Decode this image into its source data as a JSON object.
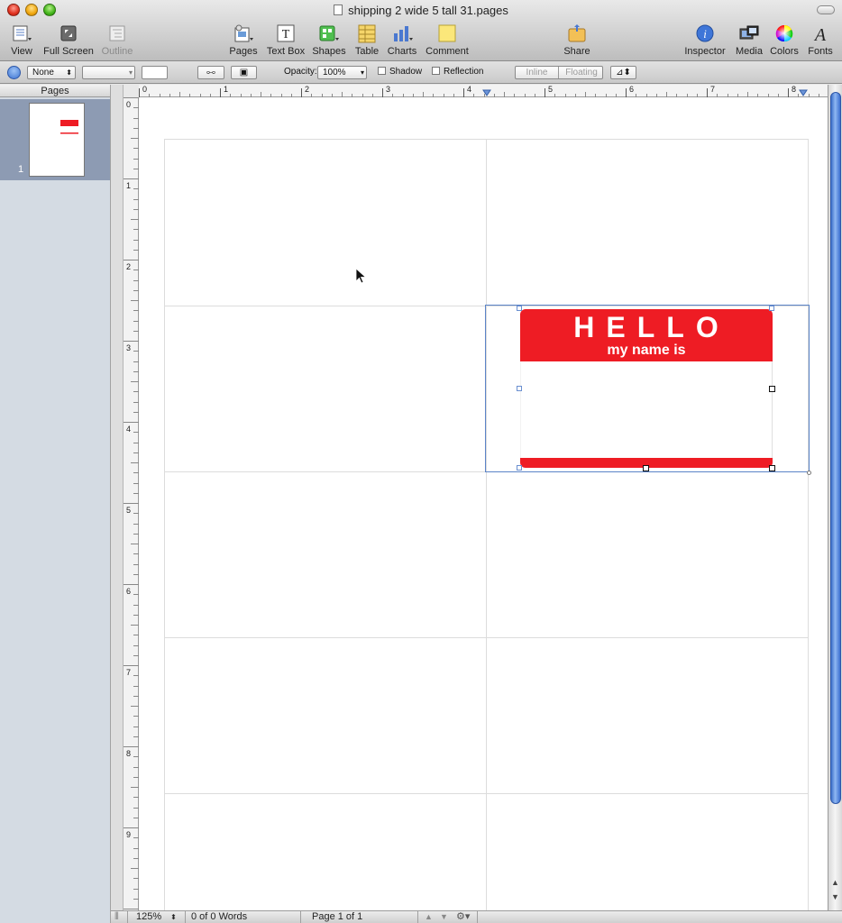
{
  "window": {
    "title": "shipping 2 wide 5 tall 31.pages"
  },
  "toolbar": {
    "view": "View",
    "full_screen": "Full Screen",
    "outline": "Outline",
    "pages": "Pages",
    "text_box": "Text Box",
    "shapes": "Shapes",
    "table": "Table",
    "charts": "Charts",
    "comment": "Comment",
    "share": "Share",
    "inspector": "Inspector",
    "media": "Media",
    "colors": "Colors",
    "fonts": "Fonts"
  },
  "format_bar": {
    "fill_select": "None",
    "opacity_label": "Opacity:",
    "opacity_value": "100%",
    "shadow_label": "Shadow",
    "reflection_label": "Reflection",
    "inline_label": "Inline",
    "floating_label": "Floating"
  },
  "sidebar": {
    "header": "Pages",
    "thumbnail_number": "1"
  },
  "rulers": {
    "horizontal": [
      "0",
      "1",
      "2",
      "3",
      "4",
      "5",
      "6",
      "7",
      "8"
    ],
    "vertical": [
      "0",
      "1",
      "2",
      "3",
      "4",
      "5",
      "6",
      "7",
      "8",
      "9"
    ]
  },
  "name_tag": {
    "title": "HELLO",
    "subtitle": "my name is"
  },
  "status_bar": {
    "zoom": "125%",
    "word_count": "0 of 0 Words",
    "page_info": "Page 1 of 1"
  },
  "colors": {
    "name_tag_red": "#ee1c24",
    "selection_blue": "#5b84c8",
    "scroll_blue": "#3c6fc9"
  }
}
